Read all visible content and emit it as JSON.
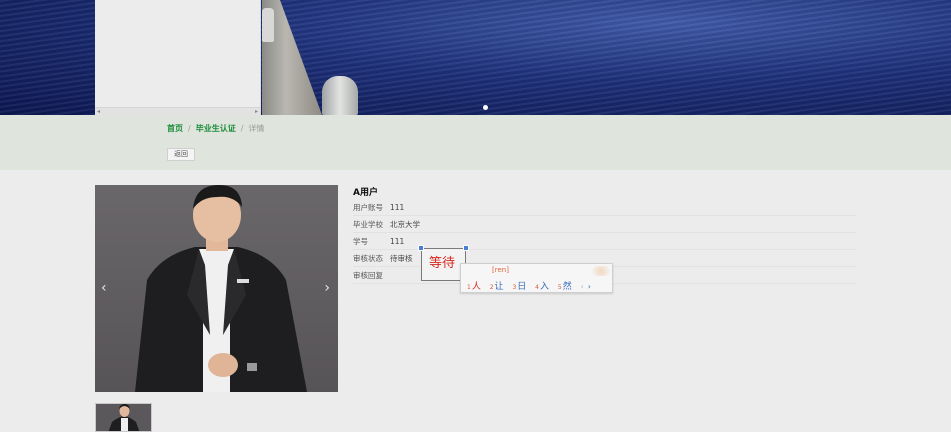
{
  "breadcrumb": {
    "home": "首页",
    "section": "毕业生认证",
    "current": "详情",
    "separator": "/"
  },
  "back_button": "返回",
  "gallery": {
    "prev_icon": "‹",
    "next_icon": "›"
  },
  "dropdown_panel": {
    "scroll_left": "◂",
    "scroll_right": "▸"
  },
  "detail": {
    "name": "A用户",
    "fields": [
      {
        "label": "用户账号",
        "value": "111"
      },
      {
        "label": "毕业学校",
        "value": "北京大学"
      },
      {
        "label": "学号",
        "value": "111"
      },
      {
        "label": "审核状态",
        "value": "待审核"
      },
      {
        "label": "审核回复",
        "value": ""
      }
    ]
  },
  "ime": {
    "composition": "等待",
    "pinyin": "[ren]",
    "candidates": [
      {
        "num": "1",
        "word": "人"
      },
      {
        "num": "2",
        "word": "让"
      },
      {
        "num": "3",
        "word": "日"
      },
      {
        "num": "4",
        "word": "入"
      },
      {
        "num": "5",
        "word": "然"
      }
    ],
    "pager_prev": "‹",
    "pager_next": "›"
  },
  "colors": {
    "link_green": "#1c8c3a",
    "breadcrumb_band": "#dfe4dc",
    "ime_red": "#d7281d",
    "ime_blue": "#3a6bbf"
  }
}
